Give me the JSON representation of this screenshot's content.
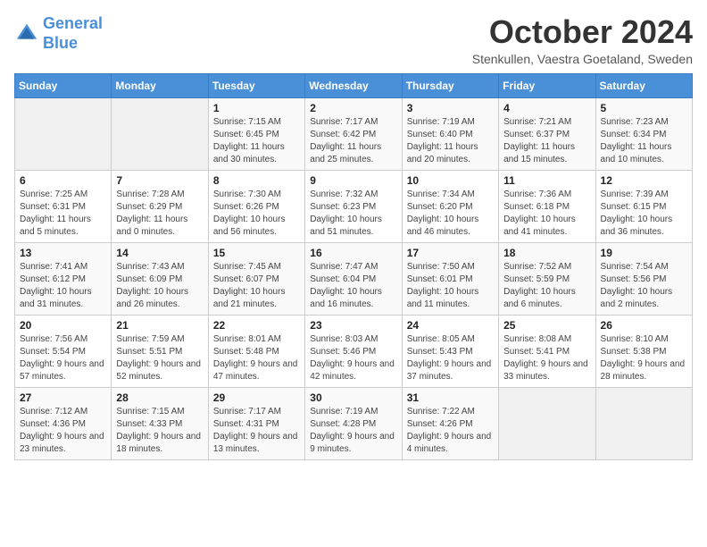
{
  "header": {
    "logo_line1": "General",
    "logo_line2": "Blue",
    "month_title": "October 2024",
    "subtitle": "Stenkullen, Vaestra Goetaland, Sweden"
  },
  "weekdays": [
    "Sunday",
    "Monday",
    "Tuesday",
    "Wednesday",
    "Thursday",
    "Friday",
    "Saturday"
  ],
  "weeks": [
    [
      {
        "day": "",
        "sunrise": "",
        "sunset": "",
        "daylight": ""
      },
      {
        "day": "",
        "sunrise": "",
        "sunset": "",
        "daylight": ""
      },
      {
        "day": "1",
        "sunrise": "Sunrise: 7:15 AM",
        "sunset": "Sunset: 6:45 PM",
        "daylight": "Daylight: 11 hours and 30 minutes."
      },
      {
        "day": "2",
        "sunrise": "Sunrise: 7:17 AM",
        "sunset": "Sunset: 6:42 PM",
        "daylight": "Daylight: 11 hours and 25 minutes."
      },
      {
        "day": "3",
        "sunrise": "Sunrise: 7:19 AM",
        "sunset": "Sunset: 6:40 PM",
        "daylight": "Daylight: 11 hours and 20 minutes."
      },
      {
        "day": "4",
        "sunrise": "Sunrise: 7:21 AM",
        "sunset": "Sunset: 6:37 PM",
        "daylight": "Daylight: 11 hours and 15 minutes."
      },
      {
        "day": "5",
        "sunrise": "Sunrise: 7:23 AM",
        "sunset": "Sunset: 6:34 PM",
        "daylight": "Daylight: 11 hours and 10 minutes."
      }
    ],
    [
      {
        "day": "6",
        "sunrise": "Sunrise: 7:25 AM",
        "sunset": "Sunset: 6:31 PM",
        "daylight": "Daylight: 11 hours and 5 minutes."
      },
      {
        "day": "7",
        "sunrise": "Sunrise: 7:28 AM",
        "sunset": "Sunset: 6:29 PM",
        "daylight": "Daylight: 11 hours and 0 minutes."
      },
      {
        "day": "8",
        "sunrise": "Sunrise: 7:30 AM",
        "sunset": "Sunset: 6:26 PM",
        "daylight": "Daylight: 10 hours and 56 minutes."
      },
      {
        "day": "9",
        "sunrise": "Sunrise: 7:32 AM",
        "sunset": "Sunset: 6:23 PM",
        "daylight": "Daylight: 10 hours and 51 minutes."
      },
      {
        "day": "10",
        "sunrise": "Sunrise: 7:34 AM",
        "sunset": "Sunset: 6:20 PM",
        "daylight": "Daylight: 10 hours and 46 minutes."
      },
      {
        "day": "11",
        "sunrise": "Sunrise: 7:36 AM",
        "sunset": "Sunset: 6:18 PM",
        "daylight": "Daylight: 10 hours and 41 minutes."
      },
      {
        "day": "12",
        "sunrise": "Sunrise: 7:39 AM",
        "sunset": "Sunset: 6:15 PM",
        "daylight": "Daylight: 10 hours and 36 minutes."
      }
    ],
    [
      {
        "day": "13",
        "sunrise": "Sunrise: 7:41 AM",
        "sunset": "Sunset: 6:12 PM",
        "daylight": "Daylight: 10 hours and 31 minutes."
      },
      {
        "day": "14",
        "sunrise": "Sunrise: 7:43 AM",
        "sunset": "Sunset: 6:09 PM",
        "daylight": "Daylight: 10 hours and 26 minutes."
      },
      {
        "day": "15",
        "sunrise": "Sunrise: 7:45 AM",
        "sunset": "Sunset: 6:07 PM",
        "daylight": "Daylight: 10 hours and 21 minutes."
      },
      {
        "day": "16",
        "sunrise": "Sunrise: 7:47 AM",
        "sunset": "Sunset: 6:04 PM",
        "daylight": "Daylight: 10 hours and 16 minutes."
      },
      {
        "day": "17",
        "sunrise": "Sunrise: 7:50 AM",
        "sunset": "Sunset: 6:01 PM",
        "daylight": "Daylight: 10 hours and 11 minutes."
      },
      {
        "day": "18",
        "sunrise": "Sunrise: 7:52 AM",
        "sunset": "Sunset: 5:59 PM",
        "daylight": "Daylight: 10 hours and 6 minutes."
      },
      {
        "day": "19",
        "sunrise": "Sunrise: 7:54 AM",
        "sunset": "Sunset: 5:56 PM",
        "daylight": "Daylight: 10 hours and 2 minutes."
      }
    ],
    [
      {
        "day": "20",
        "sunrise": "Sunrise: 7:56 AM",
        "sunset": "Sunset: 5:54 PM",
        "daylight": "Daylight: 9 hours and 57 minutes."
      },
      {
        "day": "21",
        "sunrise": "Sunrise: 7:59 AM",
        "sunset": "Sunset: 5:51 PM",
        "daylight": "Daylight: 9 hours and 52 minutes."
      },
      {
        "day": "22",
        "sunrise": "Sunrise: 8:01 AM",
        "sunset": "Sunset: 5:48 PM",
        "daylight": "Daylight: 9 hours and 47 minutes."
      },
      {
        "day": "23",
        "sunrise": "Sunrise: 8:03 AM",
        "sunset": "Sunset: 5:46 PM",
        "daylight": "Daylight: 9 hours and 42 minutes."
      },
      {
        "day": "24",
        "sunrise": "Sunrise: 8:05 AM",
        "sunset": "Sunset: 5:43 PM",
        "daylight": "Daylight: 9 hours and 37 minutes."
      },
      {
        "day": "25",
        "sunrise": "Sunrise: 8:08 AM",
        "sunset": "Sunset: 5:41 PM",
        "daylight": "Daylight: 9 hours and 33 minutes."
      },
      {
        "day": "26",
        "sunrise": "Sunrise: 8:10 AM",
        "sunset": "Sunset: 5:38 PM",
        "daylight": "Daylight: 9 hours and 28 minutes."
      }
    ],
    [
      {
        "day": "27",
        "sunrise": "Sunrise: 7:12 AM",
        "sunset": "Sunset: 4:36 PM",
        "daylight": "Daylight: 9 hours and 23 minutes."
      },
      {
        "day": "28",
        "sunrise": "Sunrise: 7:15 AM",
        "sunset": "Sunset: 4:33 PM",
        "daylight": "Daylight: 9 hours and 18 minutes."
      },
      {
        "day": "29",
        "sunrise": "Sunrise: 7:17 AM",
        "sunset": "Sunset: 4:31 PM",
        "daylight": "Daylight: 9 hours and 13 minutes."
      },
      {
        "day": "30",
        "sunrise": "Sunrise: 7:19 AM",
        "sunset": "Sunset: 4:28 PM",
        "daylight": "Daylight: 9 hours and 9 minutes."
      },
      {
        "day": "31",
        "sunrise": "Sunrise: 7:22 AM",
        "sunset": "Sunset: 4:26 PM",
        "daylight": "Daylight: 9 hours and 4 minutes."
      },
      {
        "day": "",
        "sunrise": "",
        "sunset": "",
        "daylight": ""
      },
      {
        "day": "",
        "sunrise": "",
        "sunset": "",
        "daylight": ""
      }
    ]
  ]
}
